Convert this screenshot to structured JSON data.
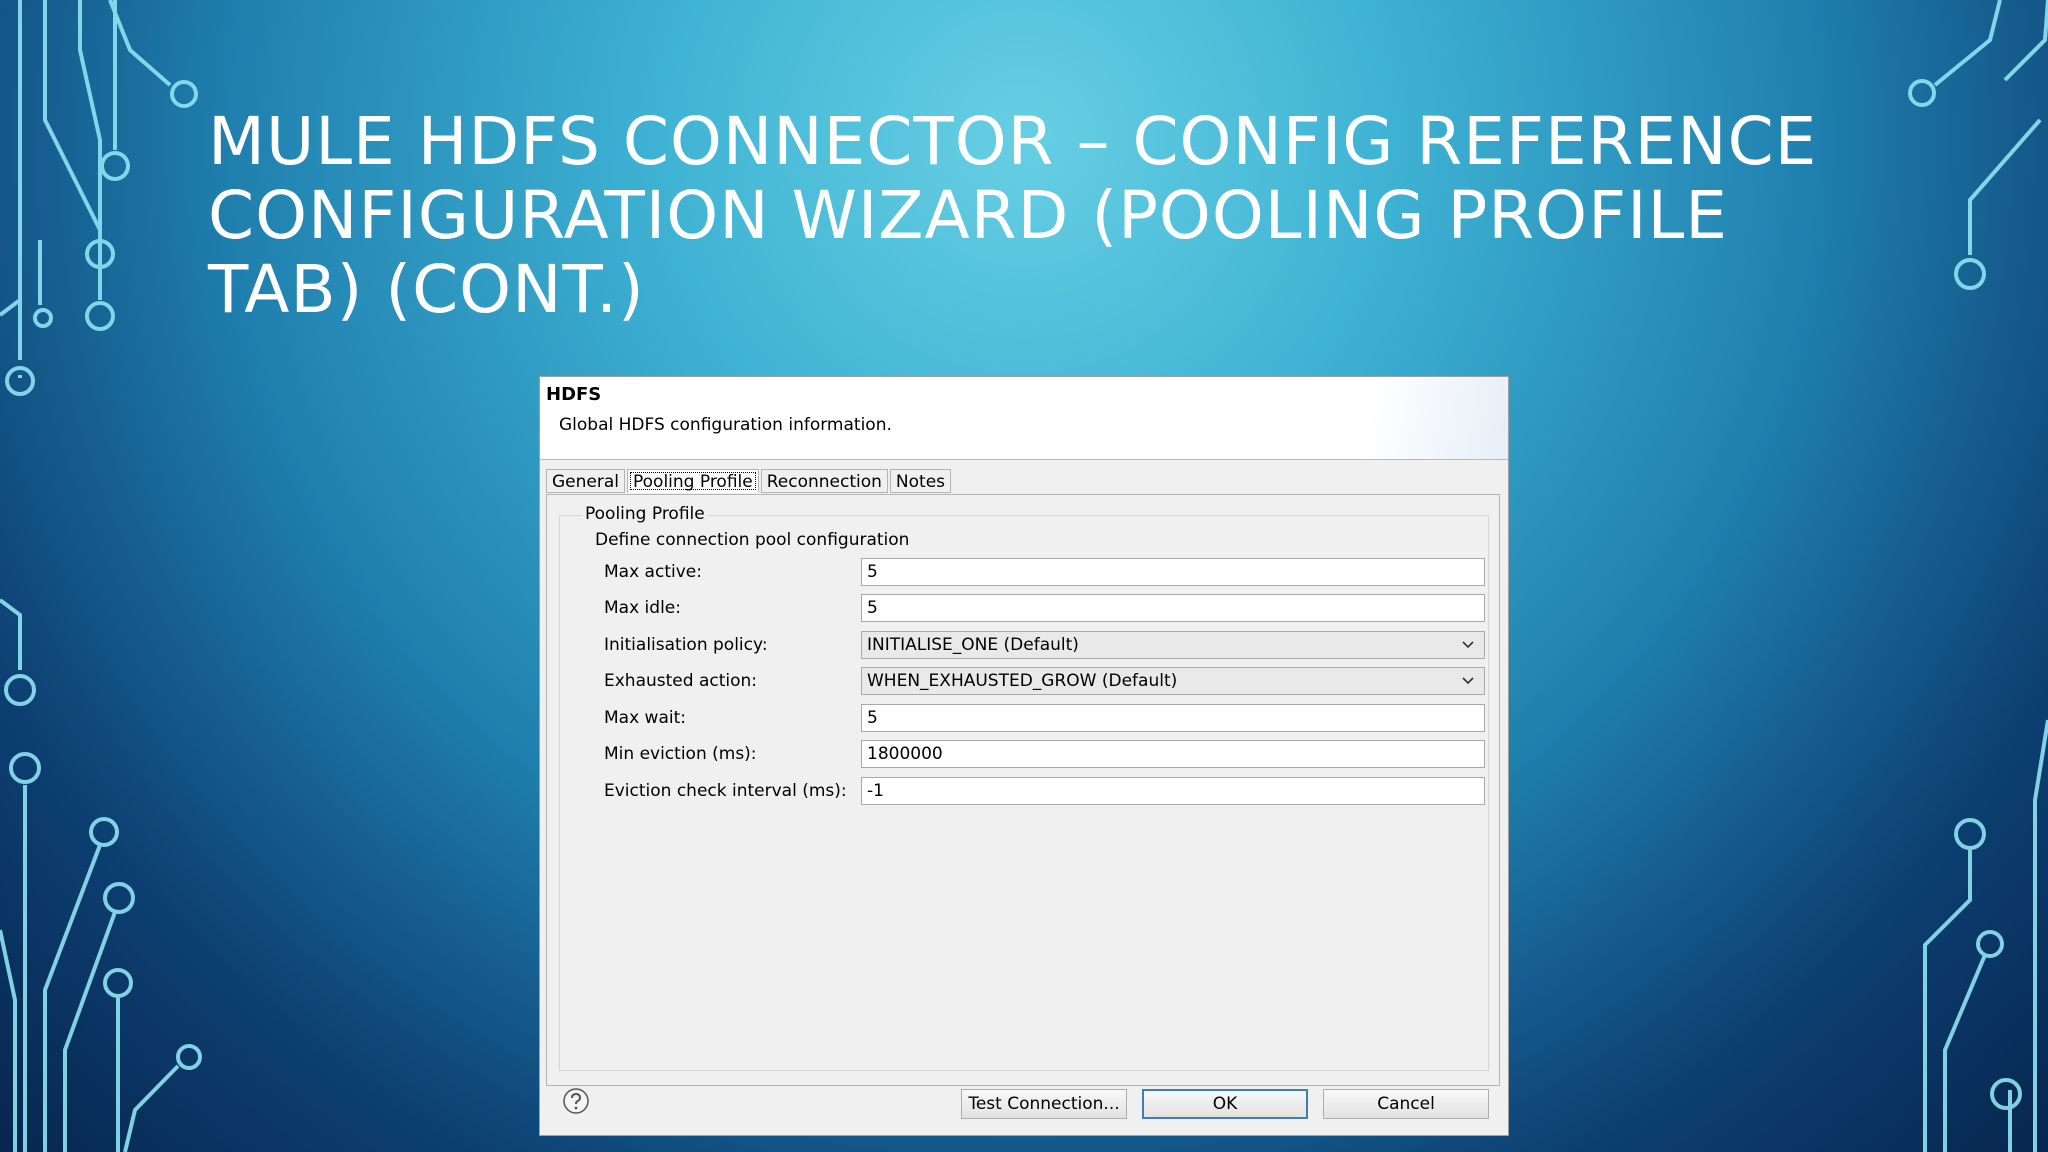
{
  "slide": {
    "title": "MULE HDFS CONNECTOR – CONFIG REFERENCE CONFIGURATION WIZARD (POOLING PROFILE TAB) (CONT.)"
  },
  "dialog": {
    "title": "HDFS",
    "description": "Global HDFS configuration information.",
    "tabs": [
      {
        "label": "General",
        "active": false
      },
      {
        "label": "Pooling Profile",
        "active": true
      },
      {
        "label": "Reconnection",
        "active": false
      },
      {
        "label": "Notes",
        "active": false
      }
    ],
    "group": {
      "legend": "Pooling Profile",
      "description": "Define connection pool configuration"
    },
    "fields": {
      "max_active": {
        "label": "Max active:",
        "value": "5"
      },
      "max_idle": {
        "label": "Max idle:",
        "value": "5"
      },
      "initialisation_policy": {
        "label": "Initialisation policy:",
        "value": "INITIALISE_ONE (Default)"
      },
      "exhausted_action": {
        "label": "Exhausted action:",
        "value": "WHEN_EXHAUSTED_GROW (Default)"
      },
      "max_wait": {
        "label": "Max wait:",
        "value": "5"
      },
      "min_eviction": {
        "label": "Min eviction (ms):",
        "value": "1800000"
      },
      "eviction_check_interval": {
        "label": "Eviction check interval (ms):",
        "value": "-1"
      }
    },
    "buttons": {
      "test_connection": "Test Connection...",
      "ok": "OK",
      "cancel": "Cancel"
    },
    "icons": {
      "help": "help-question-icon",
      "dropdown": "chevron-down-icon"
    }
  },
  "colors": {
    "background_accent": "#3fb3d4",
    "circuit": "#8fe3f2",
    "primary_button_border": "#3c7fb1"
  }
}
